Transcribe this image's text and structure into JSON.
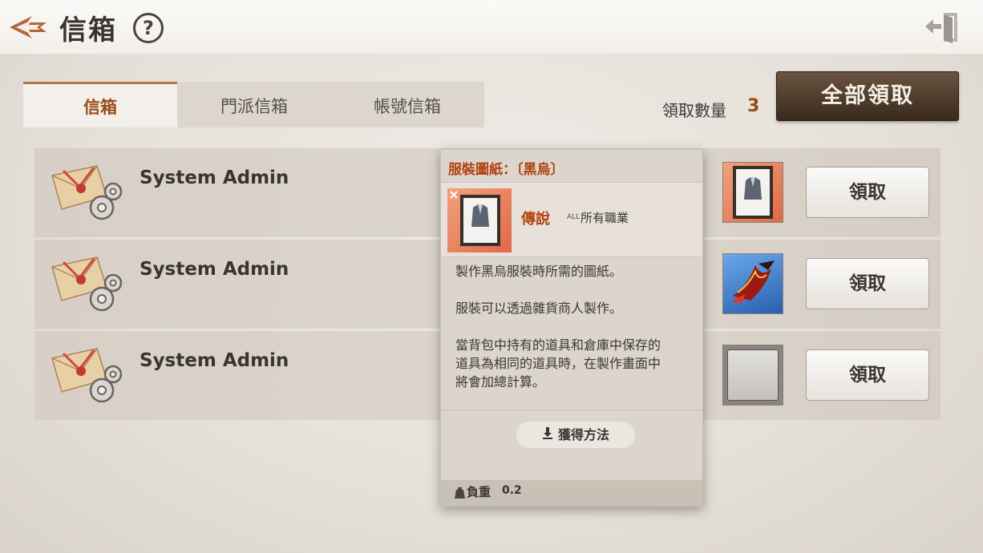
{
  "header": {
    "title": "信箱",
    "help_symbol": "?",
    "back_icon": "back-arrow-icon",
    "exit_icon": "exit-door-icon"
  },
  "tabs": [
    {
      "label": "信箱",
      "active": true
    },
    {
      "label": "門派信箱",
      "active": false
    },
    {
      "label": "帳號信箱",
      "active": false
    }
  ],
  "claim_count": {
    "label": "領取數量",
    "value": "3"
  },
  "claim_all_label": "全部領取",
  "mails": [
    {
      "sender": "System Admin",
      "claim_label": "領取",
      "item": "outfit-blueprint-icon"
    },
    {
      "sender": "System Admin",
      "claim_label": "領取",
      "item": "red-claw-weapon-icon"
    },
    {
      "sender": "System Admin",
      "claim_label": "領取",
      "item": "empty-box-icon"
    }
  ],
  "tooltip": {
    "title": "服裝圖紙：〔黑烏〕",
    "rarity": "傳說",
    "all_tag": "ALL",
    "job": "所有職業",
    "desc1": "製作黑烏服裝時所需的圖紙。",
    "desc2": "服裝可以透過雜貨商人製作。",
    "desc3_line1": "當背包中持有的道具和倉庫中保存的",
    "desc3_line2": "道具為相同的道具時，在製作畫面中",
    "desc3_line3": "將會加總計算。",
    "source_label": "獲得方法",
    "weight_label": "負重",
    "weight_value": "0.2"
  },
  "colors": {
    "accent": "#9a4a12",
    "legendary": "#b2420f",
    "claim_all_bg": "#4a3726"
  }
}
